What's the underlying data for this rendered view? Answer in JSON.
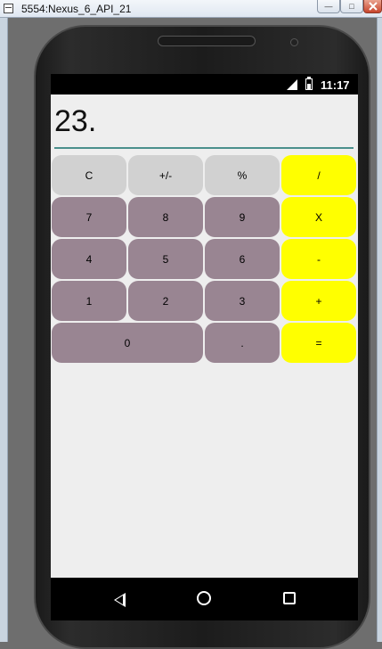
{
  "window": {
    "title": "5554:Nexus_6_API_21",
    "minimize_label": "—",
    "maximize_label": "□"
  },
  "status_bar": {
    "time": "11:17",
    "icons": [
      "signal-icon",
      "battery-icon"
    ]
  },
  "display": {
    "value": "23."
  },
  "keypad": {
    "clear": "C",
    "sign": "+/-",
    "percent": "%",
    "divide": "/",
    "seven": "7",
    "eight": "8",
    "nine": "9",
    "multiply": "X",
    "four": "4",
    "five": "5",
    "six": "6",
    "subtract": "-",
    "one": "1",
    "two": "2",
    "three": "3",
    "add": "+",
    "zero": "0",
    "decimal": ".",
    "equals": "="
  },
  "nav_bar": {
    "icons": [
      "back-icon",
      "home-icon",
      "recents-icon"
    ]
  },
  "colors": {
    "function_key": "#d1d1d1",
    "number_key": "#998592",
    "operator_key": "#ffff00",
    "display_underline": "#4b8f8c",
    "screen_background": "#eeeeee"
  }
}
